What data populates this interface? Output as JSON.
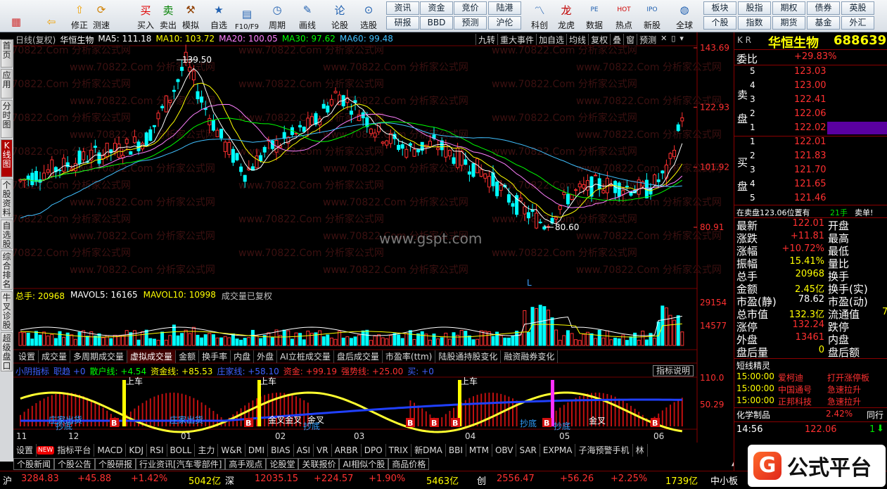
{
  "toolbar": {
    "buttons": [
      {
        "label": "",
        "icon": "grid-icon"
      },
      {
        "label": "",
        "icon": "back-arrow-icon"
      },
      {
        "label": "修正",
        "icon": "up-arrow-icon"
      },
      {
        "label": "测速",
        "icon": "refresh-icon"
      },
      {
        "label": "买入",
        "icon": "buy-icon",
        "glyph": "买"
      },
      {
        "label": "卖出",
        "icon": "sell-icon",
        "glyph": "卖"
      },
      {
        "label": "模拟",
        "icon": "gavel-icon"
      },
      {
        "label": "自选",
        "icon": "star-icon"
      },
      {
        "label": "F10/F9",
        "icon": "f10-icon"
      },
      {
        "label": "周期",
        "icon": "clock-icon"
      },
      {
        "label": "画线",
        "icon": "pencil-icon"
      },
      {
        "label": "论股",
        "icon": "chat-icon"
      },
      {
        "label": "选股",
        "icon": "search-chart-icon"
      },
      {
        "label": "科创",
        "icon": "kechuang-icon"
      },
      {
        "label": "龙虎",
        "icon": "dragon-icon"
      },
      {
        "label": "数据",
        "icon": "pe-icon"
      },
      {
        "label": "热点",
        "icon": "hot-icon"
      },
      {
        "label": "新股",
        "icon": "ipo-icon"
      },
      {
        "label": "全球",
        "icon": "globe-icon"
      }
    ],
    "quick": [
      [
        "资讯",
        "研报"
      ],
      [
        "资金",
        "BBD"
      ],
      [
        "竞价",
        "预测"
      ],
      [
        "陆港",
        "沪伦"
      ],
      [
        "板块",
        "个股"
      ],
      [
        "股指",
        "指数"
      ],
      [
        "期权",
        "期货"
      ],
      [
        "债券",
        "基金"
      ],
      [
        "英股",
        "外汇"
      ]
    ]
  },
  "left_tabs": [
    "首页",
    "应用",
    "分时图",
    "K线图",
    "个股资料",
    "自选股",
    "综合排名",
    "牛叉诊股",
    "超级盘口"
  ],
  "kline": {
    "header": [
      {
        "t": "日线(复权)",
        "c": "#c0c0c0"
      },
      {
        "t": "华恒生物",
        "c": "#ffffff"
      },
      {
        "t": "MA5: 111.18",
        "c": "#ffffff"
      },
      {
        "t": "MA10: 103.72",
        "c": "#ffff00"
      },
      {
        "t": "MA20: 100.05",
        "c": "#ff80ff"
      },
      {
        "t": "MA30: 97.62",
        "c": "#00ff00"
      },
      {
        "t": "MA60: 99.48",
        "c": "#40c0ff"
      }
    ],
    "buttons": [
      "九转",
      "重大事件",
      "加自选",
      "均线",
      "复权",
      "叠",
      "窗",
      "预测"
    ],
    "price_labels": [
      "143.69",
      "122.93",
      "101.92",
      "80.91"
    ],
    "high_label": "139.50",
    "low_label": "80.60",
    "watermark_text": "www.70822.Com 分析家公式网",
    "site": "www.gspt.com",
    "l_mark": "L"
  },
  "volume": {
    "header": [
      {
        "t": "总手: 20968",
        "c": "#ffff00"
      },
      {
        "t": "MAVOL5: 16165",
        "c": "#ffffff"
      },
      {
        "t": "MAVOL10: 10998",
        "c": "#ffff00"
      },
      {
        "t": "成交量已复权",
        "c": "#c0c0c0"
      }
    ],
    "labels": [
      "29154",
      "14577"
    ]
  },
  "mid_tabs": [
    "设置",
    "成交量",
    "多周期成交量",
    "虚拟成交量",
    "金额",
    "换手率",
    "内盘",
    "外盘",
    "AI立桩成交量",
    "盘后成交量",
    "市盈率(ttm)",
    "陆股通持股变化",
    "融资融券变化"
  ],
  "indicator": {
    "header": [
      {
        "t": "小阴指标",
        "c": "#4060ff"
      },
      {
        "t": "职趋 +0",
        "c": "#4060ff"
      },
      {
        "t": "散户线: +4.54",
        "c": "#00ff00"
      },
      {
        "t": "资金线: +85.53",
        "c": "#ffff00"
      },
      {
        "t": "庄家线: +58.10",
        "c": "#4060ff"
      },
      {
        "t": "资金: +99.19",
        "c": "#ff3030"
      },
      {
        "t": "强势线: +25.00",
        "c": "#ff3030"
      },
      {
        "t": "买: +0",
        "c": "#4060ff"
      }
    ],
    "help": "指标说明",
    "labels": [
      "110.0",
      "50.29"
    ],
    "texts": [
      "上车",
      "上车",
      "上车",
      "金叉金叉",
      "金叉",
      "金叉",
      "庄家出货",
      "庄家出货",
      "抄底",
      "抄底",
      "抄底",
      "抄底"
    ]
  },
  "months": [
    "11",
    "12",
    "01",
    "02",
    "03",
    "04",
    "05",
    "06"
  ],
  "bottom_tabs": [
    "设置",
    "指标平台",
    "MACD",
    "KDJ",
    "RSI",
    "BOLL",
    "主力",
    "W&R",
    "DMI",
    "BIAS",
    "ASI",
    "VR",
    "ARBR",
    "DPO",
    "TRIX",
    "新DMA",
    "BBI",
    "MTM",
    "OBV",
    "SAR",
    "EXPMA",
    "子海预警手机",
    "林"
  ],
  "bottom_new": "NEW",
  "news_tabs": [
    "个股新闻",
    "个股公告",
    "个股研报",
    "行业资讯[汽车零部件]",
    "高手观点",
    "论股堂",
    "关联报价",
    "AI相似个股",
    "商品价格"
  ],
  "right": {
    "header_left": "K R",
    "stock_name": "华恒生物",
    "stock_code": "688639",
    "webi": {
      "label": "委比",
      "value": "+29.83%"
    },
    "sell_side": "卖盘",
    "buy_side": "买盘",
    "asks": [
      [
        "5",
        "123.03"
      ],
      [
        "4",
        "123.00"
      ],
      [
        "3",
        "122.41"
      ],
      [
        "2",
        "122.06"
      ],
      [
        "1",
        "122.02"
      ]
    ],
    "bids": [
      [
        "1",
        "122.01"
      ],
      [
        "2",
        "121.83"
      ],
      [
        "3",
        "121.70"
      ],
      [
        "4",
        "121.65"
      ],
      [
        "5",
        "121.46"
      ]
    ],
    "position_line": "在卖盘123.06位置有",
    "position_qty": "21手",
    "position_tag": "卖单!",
    "stats": [
      [
        "最新",
        "122.01",
        "开盘",
        ""
      ],
      [
        "涨跌",
        "+11.81",
        "最高",
        ""
      ],
      [
        "涨幅",
        "+10.72%",
        "最低",
        ""
      ],
      [
        "振幅",
        "15.41%",
        "量比",
        ""
      ],
      [
        "总手",
        "20968",
        "换手",
        ""
      ],
      [
        "金额",
        "2.45亿",
        "换手(实)",
        ""
      ],
      [
        "市盈(静)",
        "78.62",
        "市盈(动)",
        ""
      ],
      [
        "总市值",
        "132.3亿",
        "流通值",
        "7"
      ],
      [
        "涨停",
        "132.24",
        "跌停",
        ""
      ],
      [
        "外盘",
        "13461",
        "内盘",
        ""
      ],
      [
        "盘后量",
        "0",
        "盘后额",
        ""
      ]
    ],
    "alerts_title": "短线精灵",
    "alerts": [
      [
        "15:00:00",
        "爱柯迪",
        "打开涨停板"
      ],
      [
        "15:00:00",
        "中国通号",
        "急速拉升"
      ],
      [
        "15:00:00",
        "正邦科技",
        "急速拉升"
      ]
    ],
    "sector": "化学制品",
    "sector_pct": "2.42%",
    "sector_more": "同行",
    "tick_time": "14:56",
    "tick_price": "122.06",
    "tick_qty": "1"
  },
  "statusbar": {
    "sh_label": "沪",
    "sh": "3284.83",
    "sh_chg": "+45.88",
    "sh_pct": "+1.42%",
    "sh_amt": "5042亿",
    "sz_label": "深",
    "sz": "12035.15",
    "sz_chg": "+224.57",
    "sz_pct": "+1.90%",
    "sz_amt": "5463亿",
    "cy_label": "创",
    "cy": "2556.47",
    "cy_chg": "+56.26",
    "cy_pct": "+2.25%",
    "cy_amt": "1739亿",
    "zx_label": "中小板"
  },
  "brand": "公式平台",
  "colors": {
    "up": "#ff3030",
    "down": "#00ffff",
    "ma5": "#ffffff",
    "ma10": "#ffff00",
    "ma20": "#ff80ff",
    "ma30": "#00ff00",
    "ma60": "#40c0ff"
  }
}
